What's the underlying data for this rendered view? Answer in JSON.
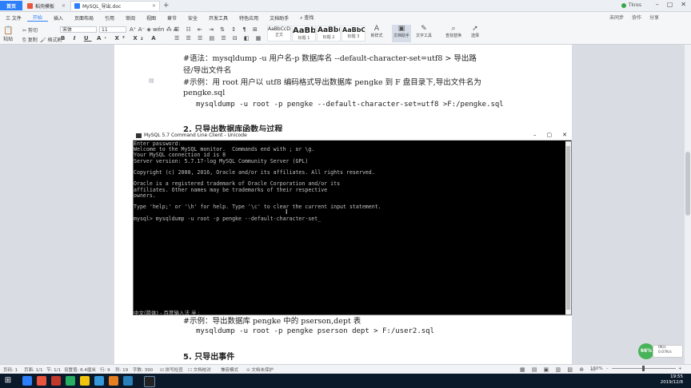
{
  "tabs": {
    "home": "首页",
    "t1": "稻壳模板",
    "t2": "MySQL_导出.doc",
    "new_tab": "+"
  },
  "window": {
    "user_name": "Tkres",
    "controls": [
      "–",
      "▢",
      "✕"
    ]
  },
  "menu": {
    "file": "三 文件",
    "items": [
      "开始",
      "插入",
      "页面布局",
      "引用",
      "审阅",
      "视图",
      "章节",
      "安全",
      "开发工具",
      "特色应用",
      "文档助手"
    ],
    "search": "查找",
    "right": [
      "未同步",
      "协作",
      "分享"
    ]
  },
  "ribbon": {
    "font_name": "宋体",
    "font_size": "11",
    "paste": "粘贴",
    "cut": "剪切",
    "copy": "复制",
    "format_painter": "格式刷",
    "styles": [
      {
        "preview": "AaBbCcDd",
        "name": "正文"
      },
      {
        "preview": "AaBb",
        "name": "标题 1"
      },
      {
        "preview": "AaBb(",
        "name": "标题 2"
      },
      {
        "preview": "AaBbC",
        "name": "标题 3"
      }
    ],
    "new_style": "新样式",
    "doc_assistant": "文档助手",
    "text_tools": "文字工具",
    "find_replace": "查找替换",
    "select": "选择"
  },
  "document": {
    "line1": "#语法：mysqldump -u 用户名-p 数据库名  --default-character-set=utf8 > 导出路",
    "line2": "径/导出文件名",
    "line3": "#示例：用 root 用户以 utf8 编码格式导出数据库 pengke 到 F 盘目录下,导出文件名为",
    "line4": "pengke.sql",
    "line5": "mysqldump -u root -p pengke --default-character-set=utf8 >F:/pengke.sql",
    "heading2": "2. 只导出数据库函数与过程",
    "line6": "#示例：导出数据库 pengke 中的 pserson,dept 表",
    "line7": "mysqldump -u root -p pengke pserson dept > F:/user2.sql",
    "heading5": "5. 只导出事件"
  },
  "console": {
    "title": "MySQL 5.7 Command Line Client - Unicode",
    "controls": [
      "–",
      "▢",
      "✕"
    ],
    "lines": [
      "Enter password:",
      "Welcome to the MySQL monitor.  Commands end with ; or \\g.",
      "Your MySQL connection id is 8",
      "Server version: 5.7.17-log MySQL Community Server (GPL)",
      "",
      "Copyright (c) 2000, 2016, Oracle and/or its affiliates. All rights reserved.",
      "",
      "Oracle is a registered trademark of Oracle Corporation and/or its",
      "affiliates. Other names may be trademarks of their respective",
      "owners.",
      "",
      "Type 'help;' or '\\h' for help. Type '\\c' to clear the current input statement.",
      "",
      "mysql> mysqldump -u root -p pengke --default-character-set_"
    ],
    "ime_text": "中文(简体) - 百度输入法 半 :"
  },
  "status": {
    "page": "页码: 1",
    "pages": "页面: 1/1",
    "section": "节: 1/1",
    "setting": "设置值: 8.4厘米",
    "row": "行: 9",
    "col": "列: 19",
    "words": "字数: 390",
    "spell": "拼写检查",
    "proof": "文档校对",
    "compat": "兼容模式",
    "protect": "文档未保护",
    "zoom": "160%"
  },
  "widget": {
    "percent": "66%",
    "speed_up": "0K/s",
    "speed_down": "0.07K/s"
  },
  "taskbar": {
    "time": "19:55",
    "date": "2019/12/8"
  }
}
